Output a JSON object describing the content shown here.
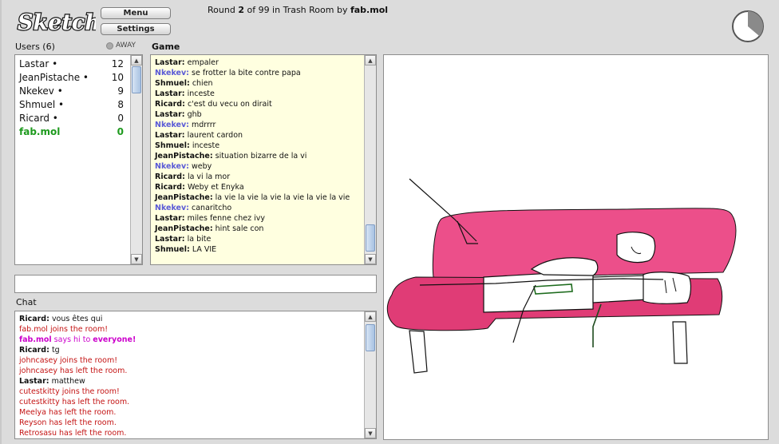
{
  "app": {
    "logo_text": "Sketch"
  },
  "toolbar": {
    "menu_label": "Menu",
    "settings_label": "Settings"
  },
  "round": {
    "prefix": "Round",
    "current": "2",
    "middle": "of 99 in Trash Room by",
    "artist": "fab.mol"
  },
  "users": {
    "header": "Users (6)",
    "away_label": "AWAY",
    "list": [
      {
        "name": "Lastar •",
        "score": "12"
      },
      {
        "name": "JeanPistache •",
        "score": "10"
      },
      {
        "name": "Nkekev •",
        "score": "9"
      },
      {
        "name": "Shmuel •",
        "score": "8"
      },
      {
        "name": "Ricard •",
        "score": "0"
      },
      {
        "name": "fab.mol",
        "score": "0"
      }
    ]
  },
  "game": {
    "header": "Game",
    "messages": [
      {
        "user": "Lastar:",
        "text": "empaler"
      },
      {
        "user": "Nkekev:",
        "text": "se frotter la bite contre papa"
      },
      {
        "user": "Shmuel:",
        "text": "chien"
      },
      {
        "user": "Lastar:",
        "text": "inceste"
      },
      {
        "user": "Ricard:",
        "text": "c'est du vecu on dirait"
      },
      {
        "user": "Lastar:",
        "text": "ghb"
      },
      {
        "user": "Nkekev:",
        "text": "mdrrrr"
      },
      {
        "user": "Lastar:",
        "text": "laurent cardon"
      },
      {
        "user": "Shmuel:",
        "text": "inceste"
      },
      {
        "user": "JeanPistache:",
        "text": "situation bizarre de la vi"
      },
      {
        "user": "Nkekev:",
        "text": "weby"
      },
      {
        "user": "Ricard:",
        "text": "la vi la mor"
      },
      {
        "user": "Ricard:",
        "text": "Weby et Enyka"
      },
      {
        "user": "JeanPistache:",
        "text": "la vie la vie la vie la vie la vie la vie"
      },
      {
        "user": "Nkekev:",
        "text": "canaritcho"
      },
      {
        "user": "Lastar:",
        "text": "miles fenne chez ivy"
      },
      {
        "user": "JeanPistache:",
        "text": "hint sale con"
      },
      {
        "user": "Lastar:",
        "text": "la bite"
      },
      {
        "user": "Shmuel:",
        "text": "LA VIE"
      }
    ]
  },
  "chat": {
    "header": "Chat",
    "input_value": "",
    "messages": [
      {
        "user": "Ricard:",
        "text": "vous êtes qui"
      },
      {
        "system": "fab.mol joins the room!"
      },
      {
        "hi_user": "fab.mol",
        "hi_text": "says hi to",
        "hi_target": "everyone!"
      },
      {
        "user": "Ricard:",
        "text": "tg"
      },
      {
        "system": "johncasey joins the room!"
      },
      {
        "system": "johncasey has left the room."
      },
      {
        "user": "Lastar:",
        "text": "matthew"
      },
      {
        "system": "cutestkitty joins the room!"
      },
      {
        "system": "cutestkitty has left the room."
      },
      {
        "system": "Meelya has left the room."
      },
      {
        "system": "Reyson has left the room."
      },
      {
        "system": "Retrosasu has left the room."
      }
    ]
  },
  "colors": {
    "couch": "#ec4f8a",
    "couch_dark": "#e03c76",
    "self_user": "#1e9a1e",
    "nick_blue": "#5a5ad6",
    "system_red": "#c41414"
  },
  "icons": {
    "timer": "pie-timer-icon",
    "away": "away-dot-icon"
  }
}
